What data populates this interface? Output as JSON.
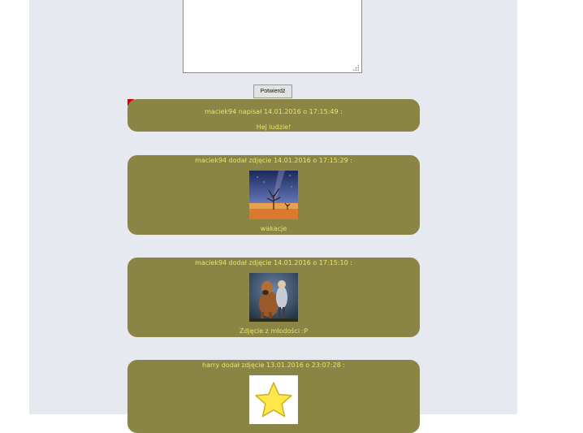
{
  "form": {
    "submit_label": "Potwierdź"
  },
  "posts": [
    {
      "header": "maciek94 napisał 14.01.2016 o 17:15:49 :",
      "body": "Hej ludzie!"
    },
    {
      "header": "maciek94 dodał zdjęcie 14.01.2016 o 17:15:29 :",
      "caption": "wakacje",
      "image": "desert-tree-night-photo"
    },
    {
      "header": "maciek94 dodał zdjęcie 14.01.2016 o 17:15:10 :",
      "caption": "Zdjęcie z młodości :P",
      "image": "dog-and-child-photo"
    },
    {
      "header": "harry dodał zdjęcie 13.01.2016 o 23:07:28 :",
      "image": "yellow-star-image"
    }
  ],
  "colors": {
    "post_bg": "#8a8544",
    "post_text": "#e8e46c",
    "page_bg": "#e7e9f1"
  }
}
